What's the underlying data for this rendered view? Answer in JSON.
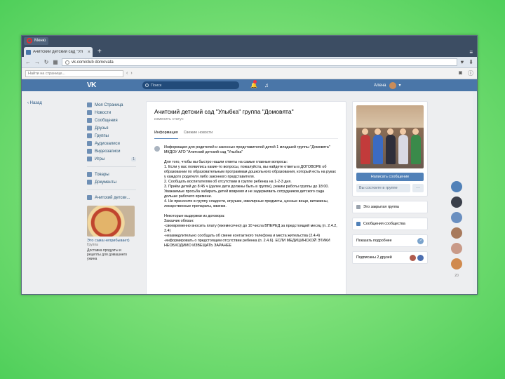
{
  "browser": {
    "menu_label": "Меню",
    "tab_title": "Ачитский детский сад \"Ул",
    "tab_close": "×",
    "new_tab": "+",
    "url": "vk.com/club domovata",
    "find_placeholder": "Найти на странице...",
    "find_prev": "‹",
    "find_next": "›"
  },
  "vk_header": {
    "logo": "VK",
    "search_placeholder": "Поиск",
    "user_name": "Алена"
  },
  "left_rail": {
    "back_label": "‹ Назад"
  },
  "sidebar": {
    "items": [
      {
        "label": "Моя Страница"
      },
      {
        "label": "Новости"
      },
      {
        "label": "Сообщения"
      },
      {
        "label": "Друзья"
      },
      {
        "label": "Группы"
      },
      {
        "label": "Аудиозаписи"
      },
      {
        "label": "Видеозаписи"
      },
      {
        "label": "Игры",
        "count": "1"
      },
      {
        "label": "Товары"
      },
      {
        "label": "Документы"
      },
      {
        "label": "Ачитский детски..."
      }
    ],
    "ad": {
      "title": "Это сама неприбывает)",
      "subtitle": "Группа",
      "text": "Доставка продукты и рецепты для домашнего ужина"
    }
  },
  "group": {
    "title": "Ачитский детский сад \"Улыбка\" группа \"Домовята\"",
    "status": "изменить статус",
    "tabs": [
      "Информация",
      "Свежие новости"
    ],
    "info_text": "Информация для родителей и законных представителей детей 1 младшей группы \"Домовята\" МКДОУ АГО \"Ачитский детский сад \"Улыбка\"\n\nДля того, чтобы вы быстро нашли ответы на самые главные вопросы:\n1. Если у вас появились какие-то вопросы, пожалуйста, вы найдете ответы в ДОГОВОРЕ об образовании по образовательным программам дошкольного образования, который есть на руках у каждого родителя либо законного представителя.\n2. Сообщать воспитателям об отсутствии в группе ребенка на 1-2-3 дня.\n3. Приём детей до 8:45 ч (далее дети должны быть в группе), режим работы группы до 18:00. Уважаемые просьба забирать детей вовремя и не задерживать сотрудников детского сада дольше рабочего времени.\n4. Не приносите в группу сладости, игрушки, ювелирные предметы, ценные вещи, витамины, лекарственные препараты, жвачки.\n\nНекоторые выдержки из договора:\nЗаказчик обязан:\n-своевременно вносить плату (ежемесячно) до 10 числа ВПЕРЕД за предстоящий месяц (п. 2.4.2, 3.4)\n-незамедлительно сообщать об смене контактного телефона и места жительства (2.4.4)\n-информировать о предстоящем отсутствии ребенка (п. 2.4.6). ЕСЛИ МЕДИЦИНСКОЙ ЭТИКИ НЕОБХОДИМО ИЗВЕЩАТЬ ЗАРАНЕЕ"
  },
  "right_col": {
    "write_message": "Написать сообщение",
    "member_status": "Вы состоите в группе",
    "more": "···",
    "closed_group": "Это закрытая группа",
    "community_messages": "Сообщения сообщества",
    "show_details": "Показать подробнее",
    "subscribed_friends": "Подписаны 2 друзей"
  },
  "chat_rail": {
    "count": "20"
  },
  "colors": {
    "vk_blue": "#4a76a8",
    "button_blue": "#5181b8",
    "background_green": "#7fe07a"
  }
}
